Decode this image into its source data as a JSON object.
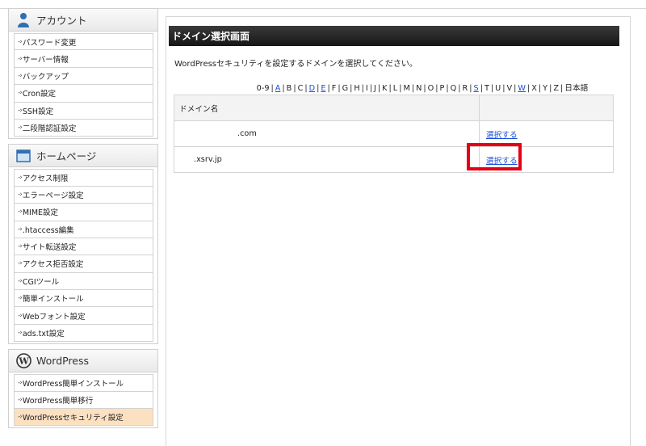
{
  "sidebar": {
    "sections": [
      {
        "title": "アカウント",
        "icon": "user-icon",
        "items": [
          "パスワード変更",
          "サーバー情報",
          "バックアップ",
          "Cron設定",
          "SSH設定",
          "二段階認証設定"
        ]
      },
      {
        "title": "ホームページ",
        "icon": "window-icon",
        "items": [
          "アクセス制限",
          "エラーページ設定",
          "MIME設定",
          ".htaccess編集",
          "サイト転送設定",
          "アクセス拒否設定",
          "CGIツール",
          "簡単インストール",
          "Webフォント設定",
          "ads.txt設定"
        ]
      },
      {
        "title": "WordPress",
        "icon": "wordpress-icon",
        "items": [
          "WordPress簡単インストール",
          "WordPress簡単移行",
          "WordPressセキュリティ設定"
        ],
        "active_index": 2
      }
    ],
    "arrow_glyph": "-›"
  },
  "main": {
    "title": "ドメイン選択画面",
    "description": "WordPressセキュリティを設定するドメインを選択してください。",
    "alphabet": [
      {
        "label": "0-9",
        "link": false
      },
      {
        "label": "A",
        "link": true
      },
      {
        "label": "B",
        "link": false
      },
      {
        "label": "C",
        "link": false
      },
      {
        "label": "D",
        "link": true
      },
      {
        "label": "E",
        "link": true
      },
      {
        "label": "F",
        "link": false
      },
      {
        "label": "G",
        "link": false
      },
      {
        "label": "H",
        "link": false
      },
      {
        "label": "I",
        "link": false
      },
      {
        "label": "J",
        "link": false
      },
      {
        "label": "K",
        "link": false
      },
      {
        "label": "L",
        "link": false
      },
      {
        "label": "M",
        "link": false
      },
      {
        "label": "N",
        "link": false
      },
      {
        "label": "O",
        "link": false
      },
      {
        "label": "P",
        "link": false
      },
      {
        "label": "Q",
        "link": false
      },
      {
        "label": "R",
        "link": false
      },
      {
        "label": "S",
        "link": true
      },
      {
        "label": "T",
        "link": false
      },
      {
        "label": "U",
        "link": false
      },
      {
        "label": "V",
        "link": false
      },
      {
        "label": "W",
        "link": true
      },
      {
        "label": "X",
        "link": false
      },
      {
        "label": "Y",
        "link": false
      },
      {
        "label": "Z",
        "link": false
      },
      {
        "label": "日本語",
        "link": false
      }
    ],
    "table": {
      "header": {
        "domain": "ドメイン名",
        "action": ""
      },
      "rows": [
        {
          "domain": ".com",
          "action": "選択する"
        },
        {
          "domain": ".xsrv.jp",
          "action": "選択する"
        }
      ]
    }
  },
  "colors": {
    "highlight": "#e60012",
    "link": "#1b4ed8",
    "active_item": "#fbe1c1"
  }
}
